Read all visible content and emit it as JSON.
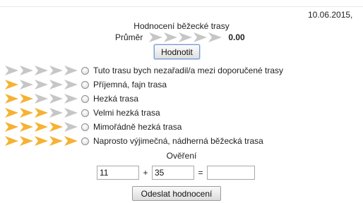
{
  "header": {
    "date": "10.06.2015,"
  },
  "rating": {
    "title": "Hodnocení běžecké trasy",
    "average_label": "Průměr",
    "average_value": "0.00",
    "average_stars_filled": 0,
    "rate_button_label": "Hodnotit"
  },
  "options": [
    {
      "stars_filled": 0,
      "label": "Tuto trasu bych nezařadil/a mezi doporučené trasy"
    },
    {
      "stars_filled": 1,
      "label": "Příjemná, fajn trasa"
    },
    {
      "stars_filled": 2,
      "label": "Hezká trasa"
    },
    {
      "stars_filled": 3,
      "label": "Velmi hezká trasa"
    },
    {
      "stars_filled": 4,
      "label": "Mimořádně hezká trasa"
    },
    {
      "stars_filled": 5,
      "label": "Naprosto výjimečná, nádherná běžecká trasa"
    }
  ],
  "verification": {
    "title": "Ověření",
    "operand_a": "11",
    "operator": "+",
    "operand_b": "35",
    "equals": "=",
    "answer": ""
  },
  "submit_label": "Odeslat hodnocení",
  "colors": {
    "arrow_filled": "#f5b233",
    "arrow_empty": "#c6c6c6"
  }
}
